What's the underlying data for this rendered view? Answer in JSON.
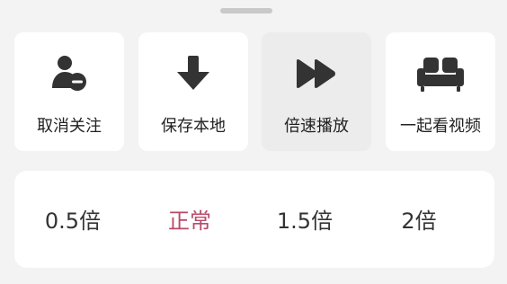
{
  "actions": [
    {
      "label": "取消关注",
      "icon": "unfollow-user-icon"
    },
    {
      "label": "保存本地",
      "icon": "download-icon"
    },
    {
      "label": "倍速播放",
      "icon": "fast-forward-icon",
      "selected": true
    },
    {
      "label": "一起看视频",
      "icon": "sofa-icon"
    }
  ],
  "speed": {
    "options": [
      "0.5倍",
      "正常",
      "1.5倍",
      "2倍"
    ],
    "selected": "正常",
    "accent_color": "#b94a68"
  }
}
